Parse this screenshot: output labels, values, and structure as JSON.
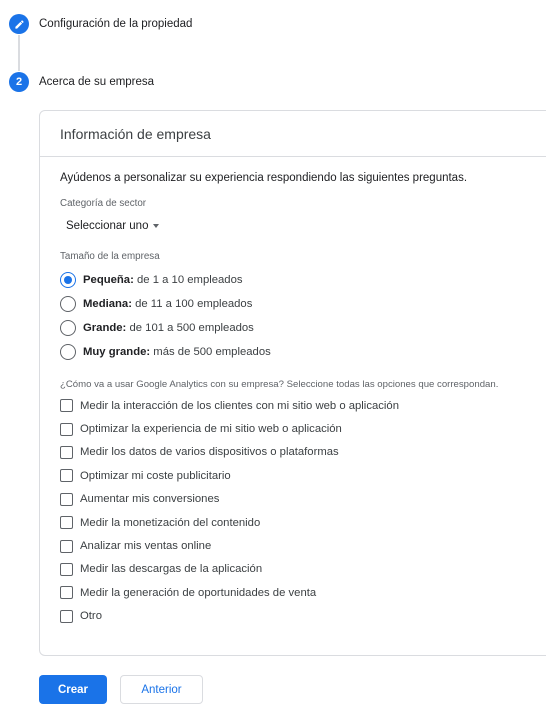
{
  "steps": [
    {
      "number": "",
      "icon": "pencil-icon",
      "label": "Configuración de la propiedad"
    },
    {
      "number": "2",
      "label": "Acerca de su empresa"
    }
  ],
  "card": {
    "title": "Información de empresa",
    "intro": "Ayúdenos a personalizar su experiencia respondiendo las siguientes preguntas.",
    "sector_label": "Categoría de sector",
    "sector_value": "Seleccionar uno",
    "size_label": "Tamaño de la empresa",
    "sizes": [
      {
        "title": "Pequeña:",
        "desc": " de 1 a 10 empleados",
        "checked": true
      },
      {
        "title": "Mediana:",
        "desc": " de 11 a 100 empleados",
        "checked": false
      },
      {
        "title": "Grande:",
        "desc": " de 101 a 500 empleados",
        "checked": false
      },
      {
        "title": "Muy grande:",
        "desc": " más de 500 empleados",
        "checked": false
      }
    ],
    "question": "¿Cómo va a usar Google Analytics con su empresa? Seleccione todas las opciones que correspondan.",
    "options": [
      "Medir la interacción de los clientes con mi sitio web o aplicación",
      "Optimizar la experiencia de mi sitio web o aplicación",
      "Medir los datos de varios dispositivos o plataformas",
      "Optimizar mi coste publicitario",
      "Aumentar mis conversiones",
      "Medir la monetización del contenido",
      "Analizar mis ventas online",
      "Medir las descargas de la aplicación",
      "Medir la generación de oportunidades de venta",
      "Otro"
    ]
  },
  "buttons": {
    "create": "Crear",
    "back": "Anterior"
  },
  "colors": {
    "accent": "#1a73e8",
    "border": "#dadce0"
  }
}
